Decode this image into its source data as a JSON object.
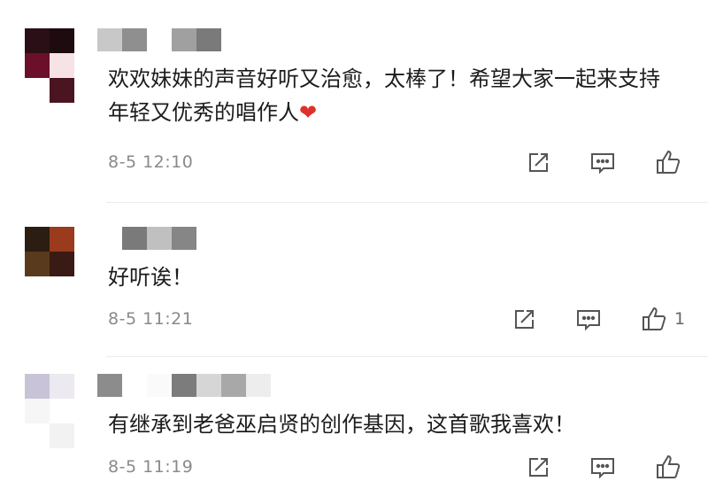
{
  "comments": [
    {
      "text": "欢欢妹妹的声音好听又治愈，太棒了！希望大家一起来支持年轻又优秀的唱作人",
      "emoji": "❤",
      "time": "8-5 12:10",
      "likes": ""
    },
    {
      "text": "好听诶！",
      "emoji": "",
      "time": "8-5 11:21",
      "likes": "1"
    },
    {
      "text": "有继承到老爸巫启贤的创作基因，这首歌我喜欢！",
      "emoji": "",
      "time": "8-5 11:19",
      "likes": ""
    }
  ],
  "icons": {
    "share": "share-icon",
    "reply": "comment-icon",
    "like": "thumbs-up-icon"
  },
  "colors": {
    "text": "#1c1c1c",
    "meta": "#8a8a8a",
    "icon": "#555555",
    "heart": "#e0302a"
  }
}
